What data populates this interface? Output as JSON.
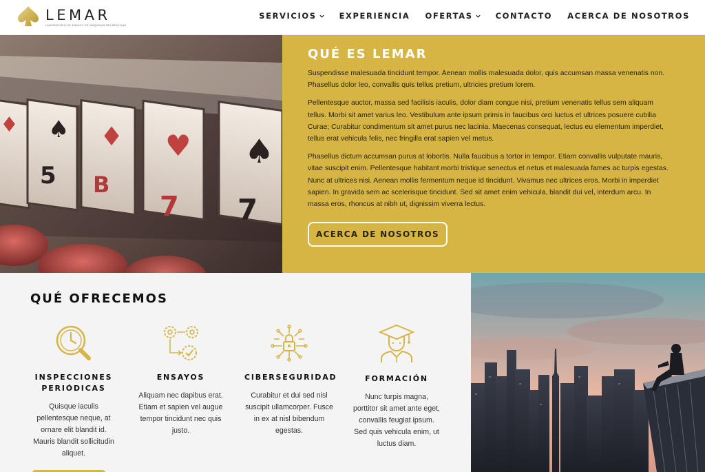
{
  "brand": {
    "name": "LEMAR",
    "tagline": "LABORATORIO DE ENSAYO DE MÁQUINAS RECREATIVAS",
    "gold": "#d6b545"
  },
  "nav": {
    "items": [
      {
        "label": "SERVICIOS",
        "dropdown": true
      },
      {
        "label": "EXPERIENCIA",
        "dropdown": false
      },
      {
        "label": "OFERTAS",
        "dropdown": true
      },
      {
        "label": "CONTACTO",
        "dropdown": false
      },
      {
        "label": "ACERCA DE NOSOTROS",
        "dropdown": false
      }
    ]
  },
  "hero": {
    "title": "QUÉ ES LEMAR",
    "paragraphs": [
      "Suspendisse malesuada tincidunt tempor. Aenean mollis malesuada dolor, quis accumsan massa venenatis non. Phasellus dolor leo, convallis quis tellus pretium, ultricies pretium lorem.",
      "Pellentesque auctor, massa sed facilisis iaculis, dolor diam congue nisi, pretium venenatis tellus sem aliquam tellus. Morbi sit amet varius leo. Vestibulum ante ipsum primis in faucibus orci luctus et ultrices posuere cubilia Curae; Curabitur condimentum sit amet purus nec lacinia. Maecenas consequat, lectus eu elementum imperdiet, tellus erat vehicula felis, nec fringilla erat sapien vel metus.",
      "Phasellus dictum accumsan purus at lobortis. Nulla faucibus a tortor in tempor. Etiam convallis vulputate mauris, vitae suscipit enim. Pellentesque habitant morbi tristique senectus et netus et malesuada fames ac turpis egestas. Nunc at ultrices nisi. Aenean mollis fermentum neque id tincidunt. Vivamus nec ultrices eros. Morbi in imperdiet sapien. In gravida sem ac scelerisque tincidunt. Sed sit amet enim vehicula, blandit dui vel, interdum arcu. In massa eros, rhoncus at nibh ut, dignissim viverra lectus."
    ],
    "button": "ACERCA DE NOSOTROS"
  },
  "offers": {
    "title": "QUÉ OFRECEMOS",
    "cards": [
      {
        "icon": "clock-magnifier-icon",
        "title": "INSPECCIONES PERIÓDICAS",
        "text": "Quisque iaculis pellentesque neque, at ornare elit blandit id. Mauris blandit sollicitudin aliquet."
      },
      {
        "icon": "gears-process-icon",
        "title": "ENSAYOS",
        "text": "Aliquam nec dapibus erat. Etiam et sapien vel augue tempor tincidunt nec quis justo."
      },
      {
        "icon": "circuit-lock-icon",
        "title": "CIBERSEGURIDAD",
        "text": "Curabitur et dui sed nisl suscipit ullamcorper. Fusce in ex at nisl bibendum egestas."
      },
      {
        "icon": "graduate-icon",
        "title": "FORMACIÓN",
        "text": "Nunc turpis magna, porttitor sit amet ante eget, convallis feugiat ipsum. Sed quis vehicula enim, ut luctus diam."
      }
    ]
  }
}
